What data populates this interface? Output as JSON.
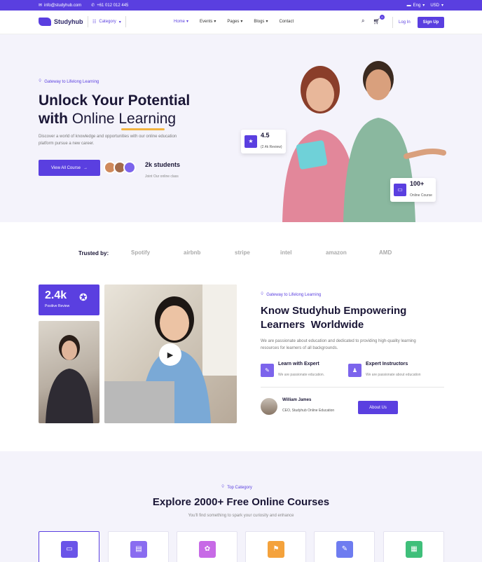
{
  "topbar": {
    "email": "info@studyhub.com",
    "phone": "+61 012 012 445",
    "language": "Eng",
    "currency": "USD"
  },
  "nav": {
    "logo": "Studyhub",
    "category": "Category",
    "menu": [
      {
        "label": "Home",
        "active": true
      },
      {
        "label": "Events",
        "active": false
      },
      {
        "label": "Pages",
        "active": false
      },
      {
        "label": "Blogs",
        "active": false
      },
      {
        "label": "Contact",
        "active": false
      }
    ],
    "cart_count": "0",
    "login": "Log In",
    "signup": "Sign Up"
  },
  "hero": {
    "tagline": "Gateway to Lifelong Learning",
    "title_line1": "Unlock Your Potential",
    "title_line2_bold": "with",
    "title_line2_light": "Online Learning",
    "description": "Discover a world of knowledge and opportunities with our online education platform pursue a new career.",
    "cta": "View All Course",
    "students_count": "2k students",
    "students_sub": "Joint Our online class",
    "rating_value": "4.5",
    "rating_sub": "(2.4k Review)",
    "courses_value": "100+",
    "courses_sub": "Online Course"
  },
  "trusted": {
    "label": "Trusted by:",
    "brands": [
      "Spotify",
      "airbnb",
      "stripe",
      "intel",
      "amazon",
      "AMD"
    ]
  },
  "about": {
    "stat_value": "2.4k",
    "stat_label": "Positive Review",
    "tagline": "Gateway to Lifelong Learning",
    "title_line1": "Know Studyhub Empowering",
    "title_line2": "Learners  Worldwide",
    "description": "We are passionate about education and dedicated to providing high-quality learning resources for learners of all backgrounds.",
    "features": [
      {
        "title": "Learn with Expert",
        "sub": "We are passionate education."
      },
      {
        "title": "Expert Instructors",
        "sub": "We are passionate about education"
      }
    ],
    "person_name": "William James",
    "person_role": "CEO, Studyhub Online Education",
    "cta": "About Us"
  },
  "categories": {
    "tagline": "Top Category",
    "title": "Explore 2000+ Free Online Courses",
    "subtitle": "You'll find something to spark your curiosity and enhance",
    "icon_colors": [
      "#6a54e8",
      "#8a6cf0",
      "#c76ae6",
      "#f4a23c",
      "#6e7cf0",
      "#3fbf7a"
    ]
  },
  "colors": {
    "accent": "#5a3fe0",
    "hero_bg": "#f4f3fb",
    "underline": "#f2b441"
  }
}
